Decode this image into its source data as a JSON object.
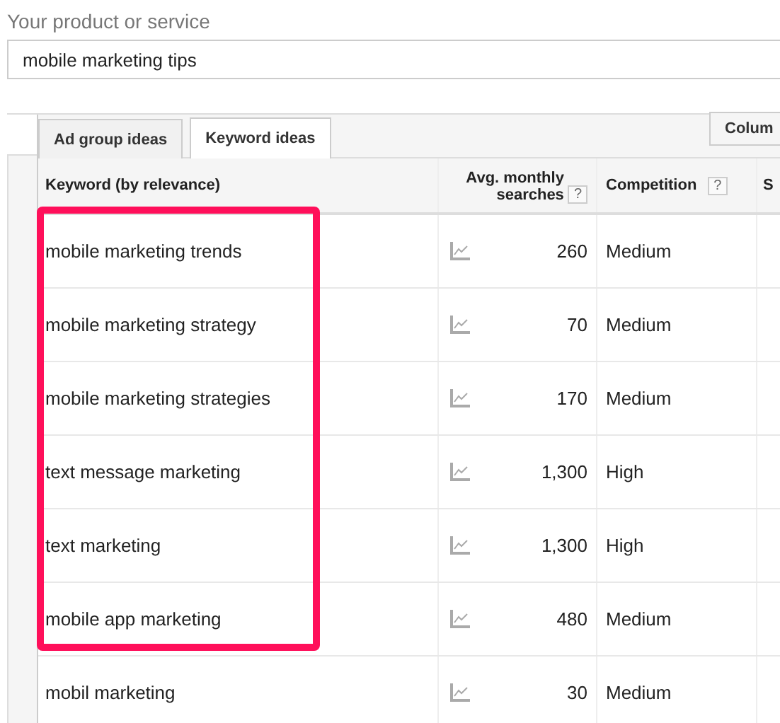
{
  "product_field": {
    "label": "Your product or service",
    "value": "mobile marketing tips"
  },
  "tabs": [
    {
      "label": "Ad group ideas",
      "selected": false
    },
    {
      "label": "Keyword ideas",
      "selected": true
    }
  ],
  "columns_button": "Colum",
  "table": {
    "columns": [
      "Keyword (by relevance)",
      "Avg. monthly searches",
      "Competition",
      "S"
    ],
    "rows": [
      {
        "keyword": "mobile marketing trends",
        "searches": "260",
        "competition": "Medium"
      },
      {
        "keyword": "mobile marketing strategy",
        "searches": "70",
        "competition": "Medium"
      },
      {
        "keyword": "mobile marketing strategies",
        "searches": "170",
        "competition": "Medium"
      },
      {
        "keyword": "text message marketing",
        "searches": "1,300",
        "competition": "High"
      },
      {
        "keyword": "text marketing",
        "searches": "1,300",
        "competition": "High"
      },
      {
        "keyword": "mobile app marketing",
        "searches": "480",
        "competition": "Medium"
      },
      {
        "keyword": "mobil marketing",
        "searches": "30",
        "competition": "Medium"
      }
    ]
  },
  "help_mark": "?"
}
